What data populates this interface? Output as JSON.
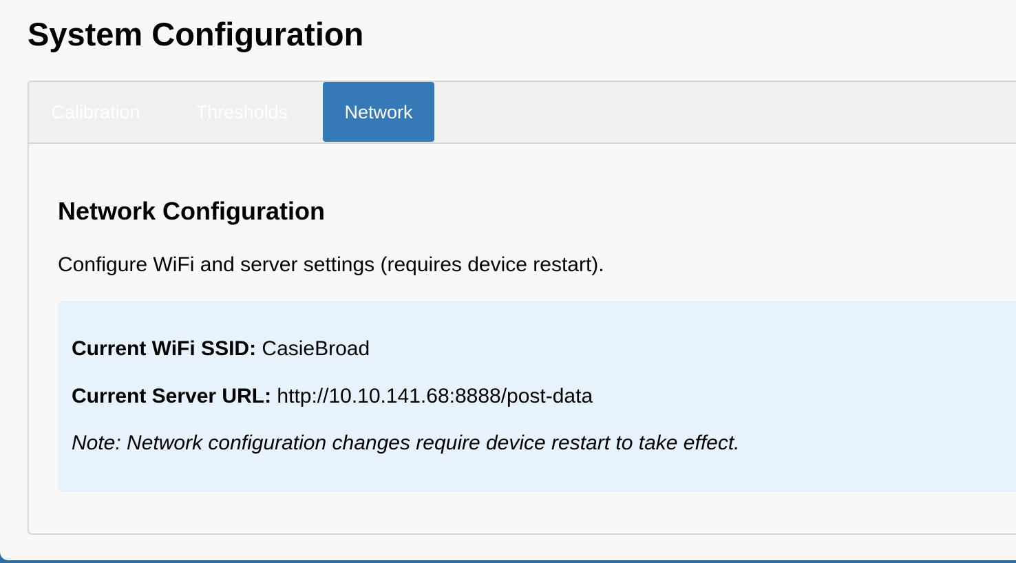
{
  "page": {
    "title": "System Configuration"
  },
  "tabs": {
    "calibration": "Calibration",
    "thresholds": "Thresholds",
    "network": "Network",
    "active": "Network",
    "active_color": "#3579b6"
  },
  "network": {
    "heading": "Network Configuration",
    "description": "Configure WiFi and server settings (requires device restart).",
    "ssid_label": "Current WiFi SSID:",
    "ssid_value": "CasieBroad",
    "server_label": "Current Server URL:",
    "server_value": "http://10.10.141.68:8888/post-data",
    "note": "Note: Network configuration changes require device restart to take effect."
  },
  "colors": {
    "background": "#f8f8f8",
    "info_box": "#e8f2fc",
    "window_edge": "#2f6ea3"
  }
}
